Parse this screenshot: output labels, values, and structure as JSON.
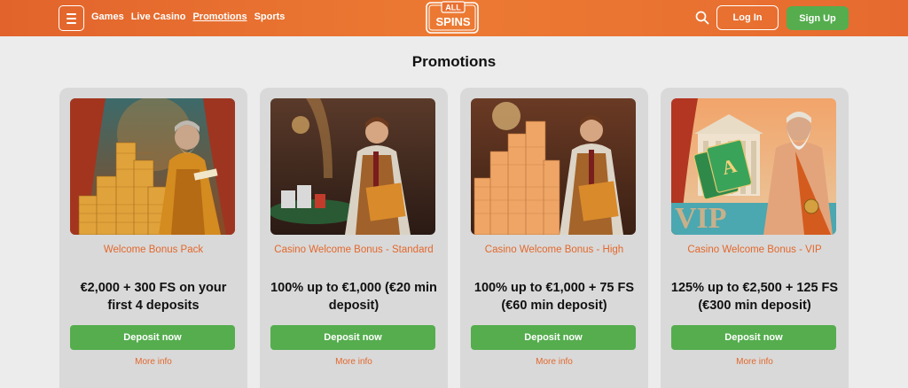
{
  "header": {
    "nav": [
      "Games",
      "Live Casino",
      "Promotions",
      "Sports"
    ],
    "active_nav": "Promotions",
    "logo": {
      "line1": "ALL",
      "line2": "SPINS"
    },
    "login_label": "Log In",
    "signup_label": "Sign Up"
  },
  "main": {
    "title": "Promotions",
    "cards": [
      {
        "title": "Welcome Bonus Pack",
        "offer": "€2,000 + 300 FS on your first 4 deposits",
        "button": "Deposit now",
        "link": "More info"
      },
      {
        "title": "Casino Welcome Bonus - Standard",
        "offer": "100% up to €1,000 (€20 min deposit)",
        "button": "Deposit now",
        "link": "More info"
      },
      {
        "title": "Casino Welcome Bonus - High",
        "offer": "100% up to €1,000 + 75 FS (€60 min deposit)",
        "button": "Deposit now",
        "link": "More info"
      },
      {
        "title": "Casino Welcome Bonus - VIP",
        "offer": "125% up to €2,500 + 125 FS (€300 min deposit)",
        "button": "Deposit now",
        "link": "More info"
      }
    ]
  },
  "colors": {
    "header": "#e96f30",
    "accent": "#e3682c",
    "green": "#55ad4e",
    "card": "#d9d9d9",
    "background": "#ececec"
  }
}
